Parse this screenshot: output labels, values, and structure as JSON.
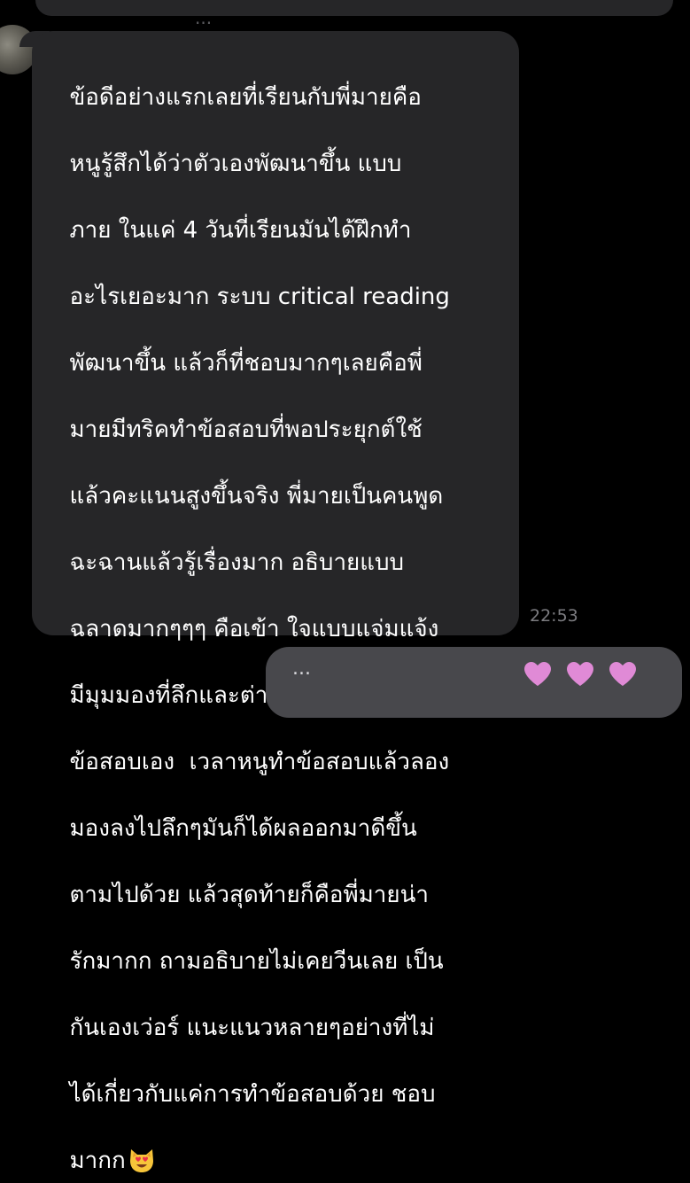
{
  "previous_message": {
    "text": "..."
  },
  "message": {
    "lines": [
      "ข้อดีอย่างแรกเลยที่เรียนกับพี่มายคือ",
      "หนูรู้สึกได้ว่าตัวเองพัฒนาขึ้น แบบ",
      "ภาย ในแค่ 4 วันที่เรียนมันได้ฝึกทำ",
      "อะไรเยอะมาก ระบบ critical reading",
      "พัฒนาขึ้น แล้วก็ที่ชอบมากๆเลยคือพี่",
      "มายมีทริคทำข้อสอบที่พอประยุกต์ใช้",
      "แล้วคะแนนสูงขึ้นจริง พี่มายเป็นคนพูด",
      "ฉะฉานแล้วรู้เรื่องมาก อธิบายแบบ",
      "ฉลาดมากๆๆๆ คือเข้า ใจแบบแจ่มแจ้ง",
      "มีมุมมองที่ลึกและต่างจากที่หนูอ่าน",
      "ข้อสอบเอง  เวลาหนูทำข้อสอบแล้วลอง",
      "มองลงไปลึกๆมันก็ได้ผลออกมาดีขึ้น",
      "ตามไปด้วย แล้วสุดท้ายก็คือพี่มายน่า",
      "รักมากก ถามอธิบายไม่เคยวีนเลย เป็น",
      "กันเองเว่อร์ แนะแนวหลายๆอย่างที่ไม่",
      "ได้เกี่ยวกับแค่การทำข้อสอบด้วย ชอบ",
      "มากก"
    ],
    "emoji": "smiling-cat-heart-eyes",
    "time": "22:53"
  },
  "next_message": {
    "text": "...",
    "emoji": "heart"
  },
  "colors": {
    "background": "#000000",
    "incoming_bubble": "#262628",
    "outgoing_bubble": "#48484c",
    "text": "#ffffff",
    "timestamp": "#7c7c80",
    "heart": "#e08ad6"
  }
}
